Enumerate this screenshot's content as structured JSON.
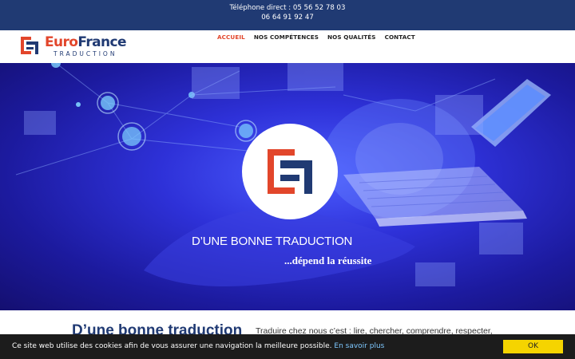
{
  "topbar": {
    "phone_label": "Téléphone direct : 05 56 52 78 03",
    "phone_secondary": "06 64 91 92 47"
  },
  "logo": {
    "euro": "Euro",
    "france": "France",
    "subtitle": "TRADUCTION"
  },
  "nav": {
    "items": [
      {
        "label": "ACCUEIL",
        "active": true
      },
      {
        "label": "NOS COMPÉTENCES",
        "active": false
      },
      {
        "label": "NOS QUALITÉS",
        "active": false
      },
      {
        "label": "CONTACT",
        "active": false
      }
    ]
  },
  "hero": {
    "title": "D’UNE BONNE TRADUCTION",
    "subtitle": "...dépend la réussite"
  },
  "content": {
    "title": "D’une bonne traduction",
    "text": "Traduire chez nous c’est : lire, chercher, comprendre, respecter,"
  },
  "cookie": {
    "message": "Ce site web utilise des cookies afin de vous assurer une navigation la meilleure possible.",
    "link": "En savoir plus",
    "ok": "OK"
  },
  "colors": {
    "topbar": "#203a73",
    "brand_red": "#e2462b",
    "brand_blue": "#203a73",
    "cookie_bg": "#1c1c1c",
    "cookie_button": "#f5d400"
  }
}
